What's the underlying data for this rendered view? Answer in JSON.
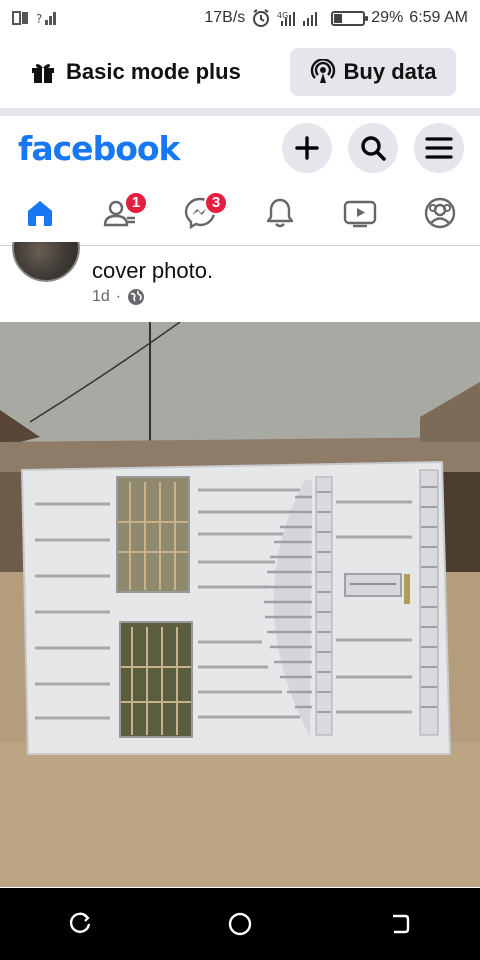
{
  "status_bar": {
    "network_speed": "17B/s",
    "battery": "29%",
    "battery_level": 0.29,
    "time": "6:59 AM"
  },
  "promo": {
    "title": "Basic mode plus",
    "buy_label": "Buy data"
  },
  "header": {
    "logo": "facebook",
    "brand_color": "#1877f2"
  },
  "nav": {
    "items": [
      {
        "name": "home",
        "icon": "home-icon",
        "badge": ""
      },
      {
        "name": "friends",
        "icon": "friends-icon",
        "badge": "1"
      },
      {
        "name": "messenger",
        "icon": "messenger-icon",
        "badge": "3"
      },
      {
        "name": "notifications",
        "icon": "bell-icon",
        "badge": ""
      },
      {
        "name": "watch",
        "icon": "video-icon",
        "badge": ""
      },
      {
        "name": "profile",
        "icon": "profile-icon",
        "badge": ""
      }
    ]
  },
  "post": {
    "text": "cover photo.",
    "time": "1d",
    "separator": "·",
    "privacy_icon": "globe-icon"
  },
  "system_nav": {
    "items": [
      "recent-apps-icon",
      "home-circle-icon",
      "back-icon"
    ]
  }
}
